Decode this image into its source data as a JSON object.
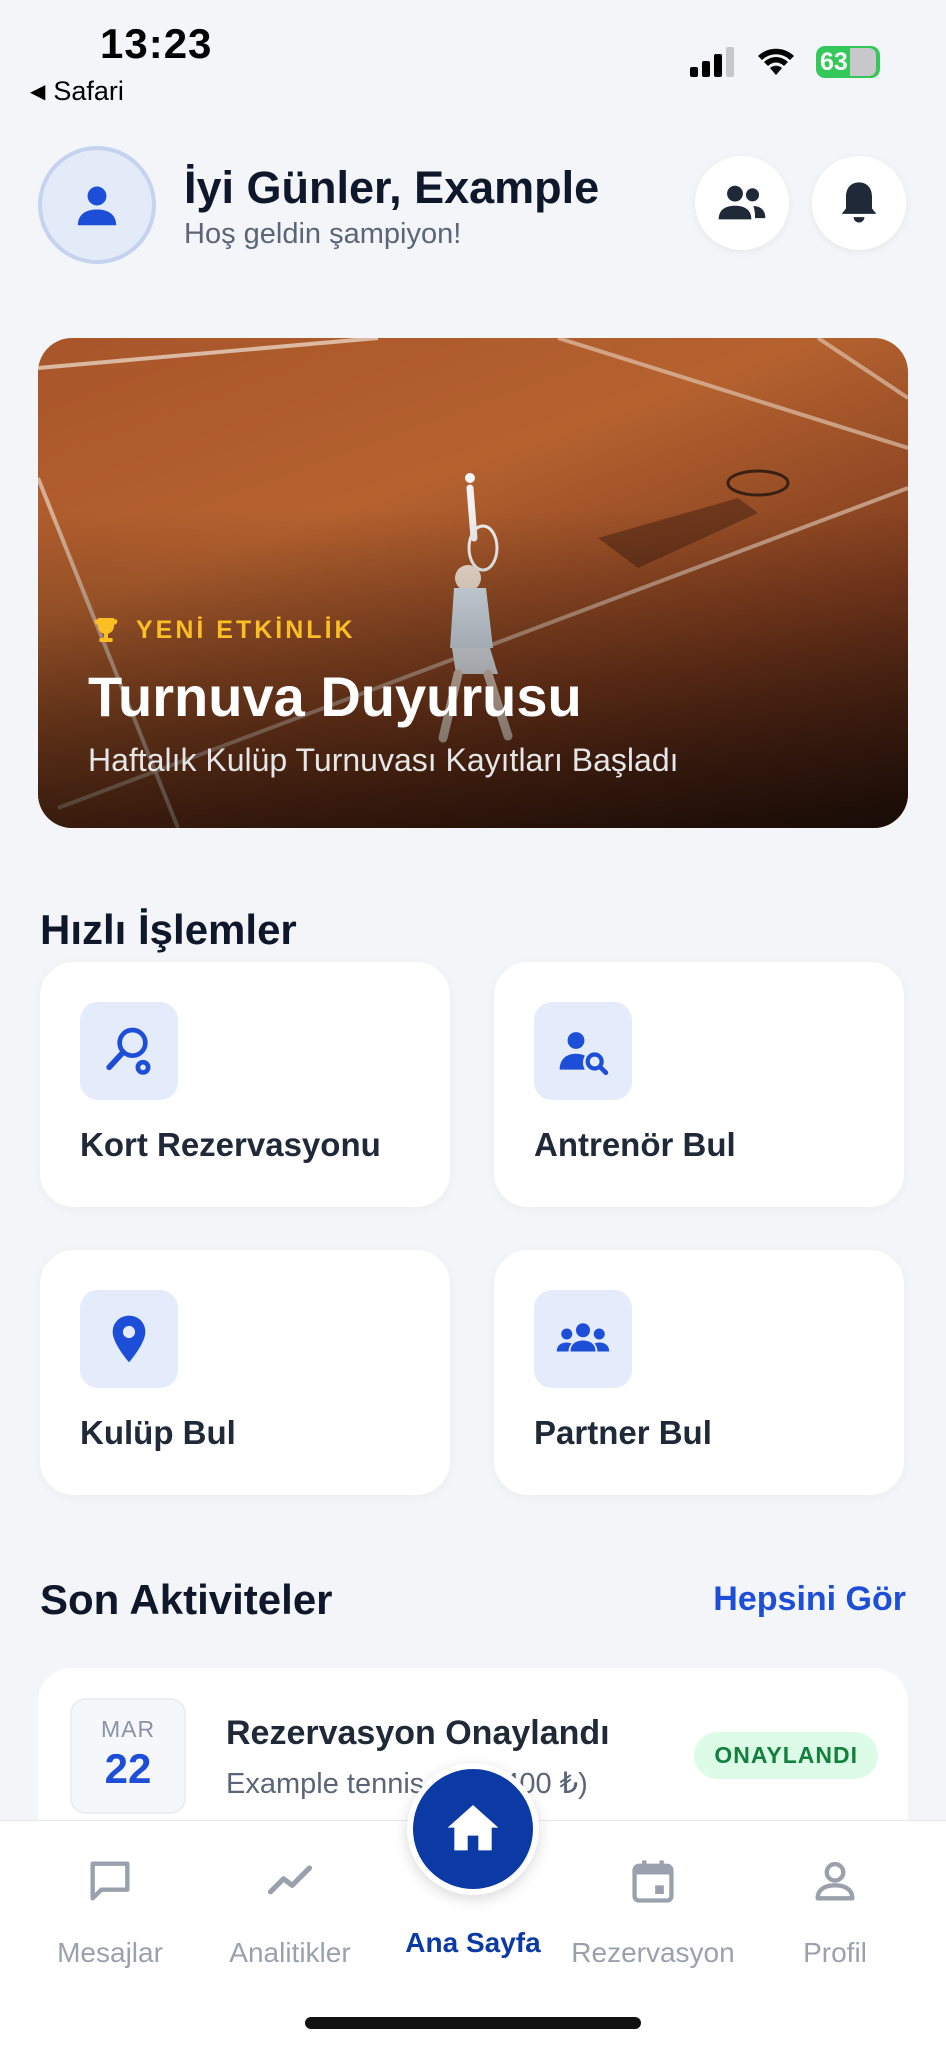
{
  "status_bar": {
    "time": "13:23",
    "back_label": "Safari",
    "battery": "63"
  },
  "header": {
    "greeting": "İyi Günler, Example",
    "subtitle": "Hoş geldin şampiyon!"
  },
  "banner": {
    "tag": "YENİ ETKİNLİK",
    "title": "Turnuva Duyurusu",
    "subtitle": "Haftalık Kulüp Turnuvası Kayıtları Başladı"
  },
  "quick_actions": {
    "title": "Hızlı İşlemler",
    "items": [
      {
        "label": "Kort Rezervasyonu",
        "icon": "tennis-racket-icon"
      },
      {
        "label": "Antrenör Bul",
        "icon": "person-search-icon"
      },
      {
        "label": "Kulüp Bul",
        "icon": "location-pin-icon"
      },
      {
        "label": "Partner Bul",
        "icon": "group-icon"
      }
    ]
  },
  "recent": {
    "title": "Son Aktiviteler",
    "see_all": "Hepsini Gör",
    "items": [
      {
        "month": "MAR",
        "day": "22",
        "title": "Rezervasyon Onaylandı",
        "subtitle": "Example tennis club (400 ₺)",
        "status": "ONAYLANDI"
      }
    ]
  },
  "nav": {
    "items": [
      {
        "label": "Mesajlar"
      },
      {
        "label": "Analitikler"
      },
      {
        "label": "Ana Sayfa"
      },
      {
        "label": "Rezervasyon"
      },
      {
        "label": "Profil"
      }
    ]
  },
  "colors": {
    "primary": "#0b3aa5",
    "accent": "#1d4ed8",
    "success": "#15803d",
    "gold": "#fbbf24"
  }
}
